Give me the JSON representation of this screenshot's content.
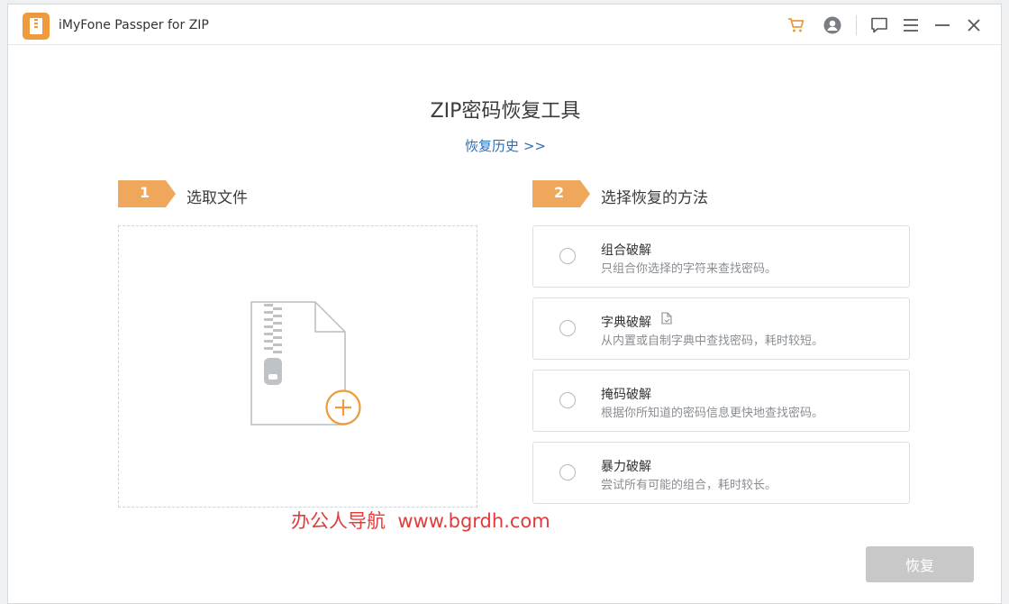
{
  "app": {
    "title": "iMyFone Passper for ZIP",
    "accent_color": "#ef9a3c",
    "icons": [
      "cart-icon",
      "user-icon",
      "feedback-icon",
      "menu-icon",
      "minimize-icon",
      "close-icon"
    ]
  },
  "main": {
    "title": "ZIP密码恢复工具",
    "history_link": "恢复历史 >>"
  },
  "steps": [
    {
      "number": "1",
      "label": "选取文件"
    },
    {
      "number": "2",
      "label": "选择恢复的方法"
    }
  ],
  "methods": [
    {
      "title": "组合破解",
      "desc": "只组合你选择的字符来查找密码。"
    },
    {
      "title": "字典破解",
      "desc": "从内置或自制字典中查找密码，耗时较短。"
    },
    {
      "title": "掩码破解",
      "desc": "根据你所知道的密码信息更快地查找密码。"
    },
    {
      "title": "暴力破解",
      "desc": "尝试所有可能的组合，耗时较长。"
    }
  ],
  "watermark": "办公人导航  www.bgrdh.com",
  "recover_button": "恢复"
}
